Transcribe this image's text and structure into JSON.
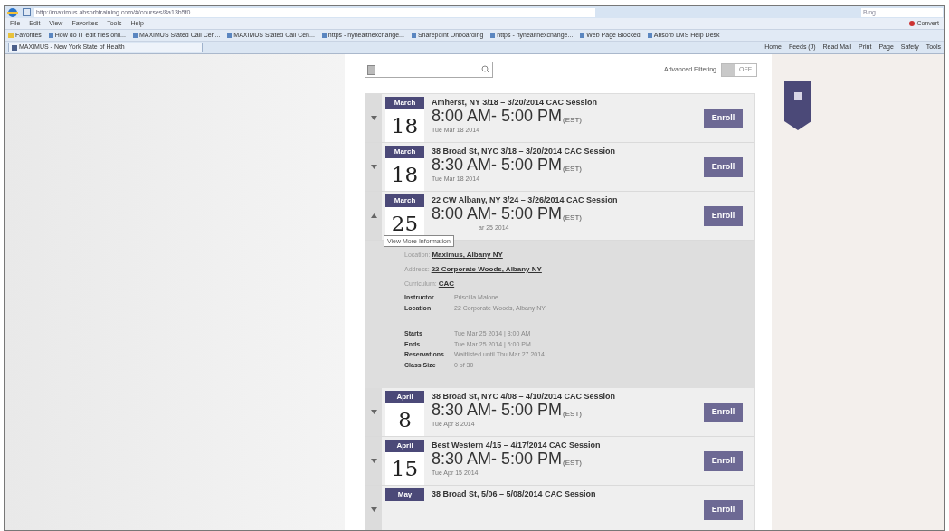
{
  "browser": {
    "address": "http://maximus.absorbtraining.com/#/courses/8a13b5f0",
    "search_placeholder": "Bing",
    "menu": [
      "File",
      "Edit",
      "View",
      "Favorites",
      "Tools",
      "Help"
    ],
    "convert": "Convert",
    "favorites_label": "Favorites",
    "favorites": [
      "How do IT edit files onli...",
      "MAXIMUS Stated Call Cen...",
      "MAXIMUS Stated Call Cen...",
      "https - nyhealthexchange...",
      "Sharepoint Onboarding",
      "https - nyhealthexchange...",
      "Web Page Blocked",
      "Absorb LMS Help Desk"
    ],
    "tab_title": "MAXIMUS - New York State of Health",
    "commands": [
      "Home",
      "Feeds (J)",
      "Read Mail",
      "Print",
      "Page",
      "Safety",
      "Tools"
    ]
  },
  "page": {
    "advanced_filtering": {
      "label": "Advanced Filtering",
      "state": "OFF",
      "on": false
    },
    "sessions": [
      {
        "month": "March",
        "day": "18",
        "title": "Amherst, NY 3/18 – 3/20/2014 CAC Session",
        "time": "8:00 AM- 5:00 PM",
        "zone": "(EST)",
        "date": "Tue Mar 18 2014",
        "expanded": false,
        "button": "Enroll"
      },
      {
        "month": "March",
        "day": "18",
        "title": "38 Broad St, NYC 3/18 – 3/20/2014 CAC Session",
        "time": "8:30 AM- 5:00 PM",
        "zone": "(EST)",
        "date": "Tue Mar 18 2014",
        "expanded": false,
        "button": "Enroll"
      },
      {
        "month": "March",
        "day": "25",
        "title": "22 CW Albany, NY 3/24 – 3/26/2014 CAC Session",
        "time": "8:00 AM- 5:00 PM",
        "zone": "(EST)",
        "date": "ar 25 2014",
        "expanded": true,
        "button": "Enroll",
        "tooltip": "View More Information",
        "links": [
          {
            "label": "Location:",
            "value": "Maximus, Albany NY"
          },
          {
            "label": "Address:",
            "value": "22 Corporate Woods, Albany NY"
          },
          {
            "label": "Curriculum:",
            "value": "CAC"
          }
        ],
        "facts_a": [
          {
            "label": "Instructor",
            "value": "Priscilla Malone"
          },
          {
            "label": "Location",
            "value": "22 Corporate Woods, Albany NY"
          }
        ],
        "facts_b": [
          {
            "label": "Starts",
            "value": "Tue Mar 25 2014 | 8:00 AM"
          },
          {
            "label": "Ends",
            "value": "Tue Mar 25 2014 | 5:00 PM"
          },
          {
            "label": "Reservations",
            "value": "Waitlisted until Thu Mar 27 2014"
          },
          {
            "label": "Class Size",
            "value": "0 of 30"
          }
        ]
      },
      {
        "month": "April",
        "day": "8",
        "title": "38 Broad St, NYC 4/08 – 4/10/2014 CAC Session",
        "time": "8:30 AM- 5:00 PM",
        "zone": "(EST)",
        "date": "Tue Apr 8 2014",
        "expanded": false,
        "button": "Enroll"
      },
      {
        "month": "April",
        "day": "15",
        "title": "Best Western 4/15 – 4/17/2014 CAC Session",
        "time": "8:30 AM- 5:00 PM",
        "zone": "(EST)",
        "date": "Tue Apr 15 2014",
        "expanded": false,
        "button": "Enroll"
      },
      {
        "month": "May",
        "title": "38 Broad St, 5/06 – 5/08/2014 CAC Session",
        "expanded": false,
        "button": "Enroll"
      }
    ]
  }
}
